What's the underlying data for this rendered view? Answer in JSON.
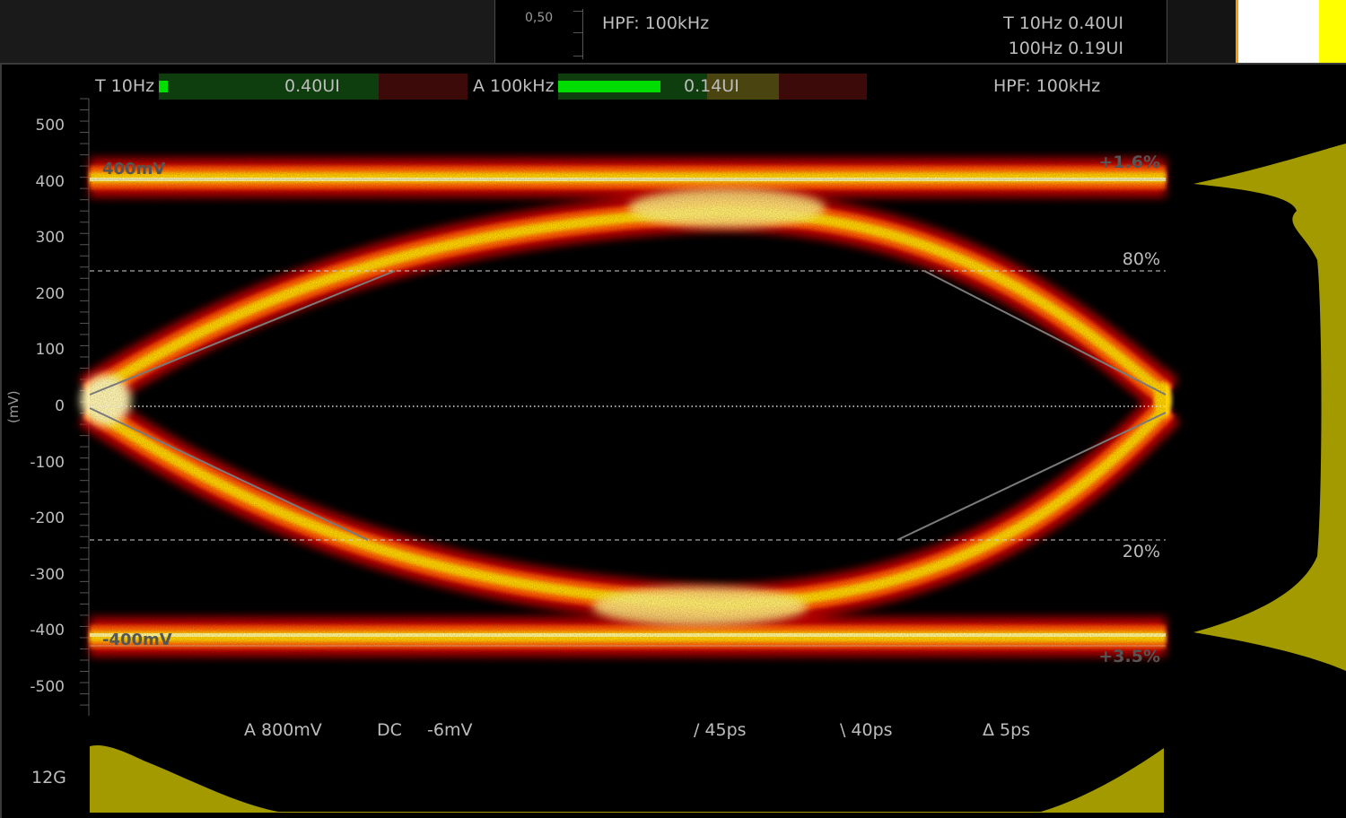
{
  "top_panel": {
    "scale_value": "0,50",
    "hpf_label": "HPF: 100kHz",
    "jitter_line1": "T 10Hz 0.40UI",
    "jitter_line2": "100Hz 0.19UI"
  },
  "meters": {
    "t_label": "T 10Hz",
    "t_value": "0.40UI",
    "t_fill_fraction": 0.03,
    "a_label": "A 100kHz",
    "a_value": "0.14UI",
    "a_fill_fraction": 0.33,
    "hpf_label": "HPF: 100kHz"
  },
  "eye": {
    "y_axis_unit": "(mV)",
    "y_ticks": [
      "500",
      "400",
      "300",
      "200",
      "100",
      "0",
      "-100",
      "-200",
      "-300",
      "-400",
      "-500"
    ],
    "upper_level_label": "400mV",
    "lower_level_label": "-400mV",
    "overshoot_top": "+1.6%",
    "overshoot_bottom": "+3.5%",
    "level_80": "80%",
    "level_20": "20%"
  },
  "measurements": {
    "amplitude": "A  800mV",
    "dc_label": "DC",
    "dc_value": "-6mV",
    "rise": "/ 45ps",
    "fall": "\\ 40ps",
    "delta": "Δ  5ps"
  },
  "bottom": {
    "rate_label": "12G"
  },
  "colors": {
    "histogram": "#a39a00",
    "meter_fill": "#00dd00",
    "top_yellow": "#ffff00"
  }
}
